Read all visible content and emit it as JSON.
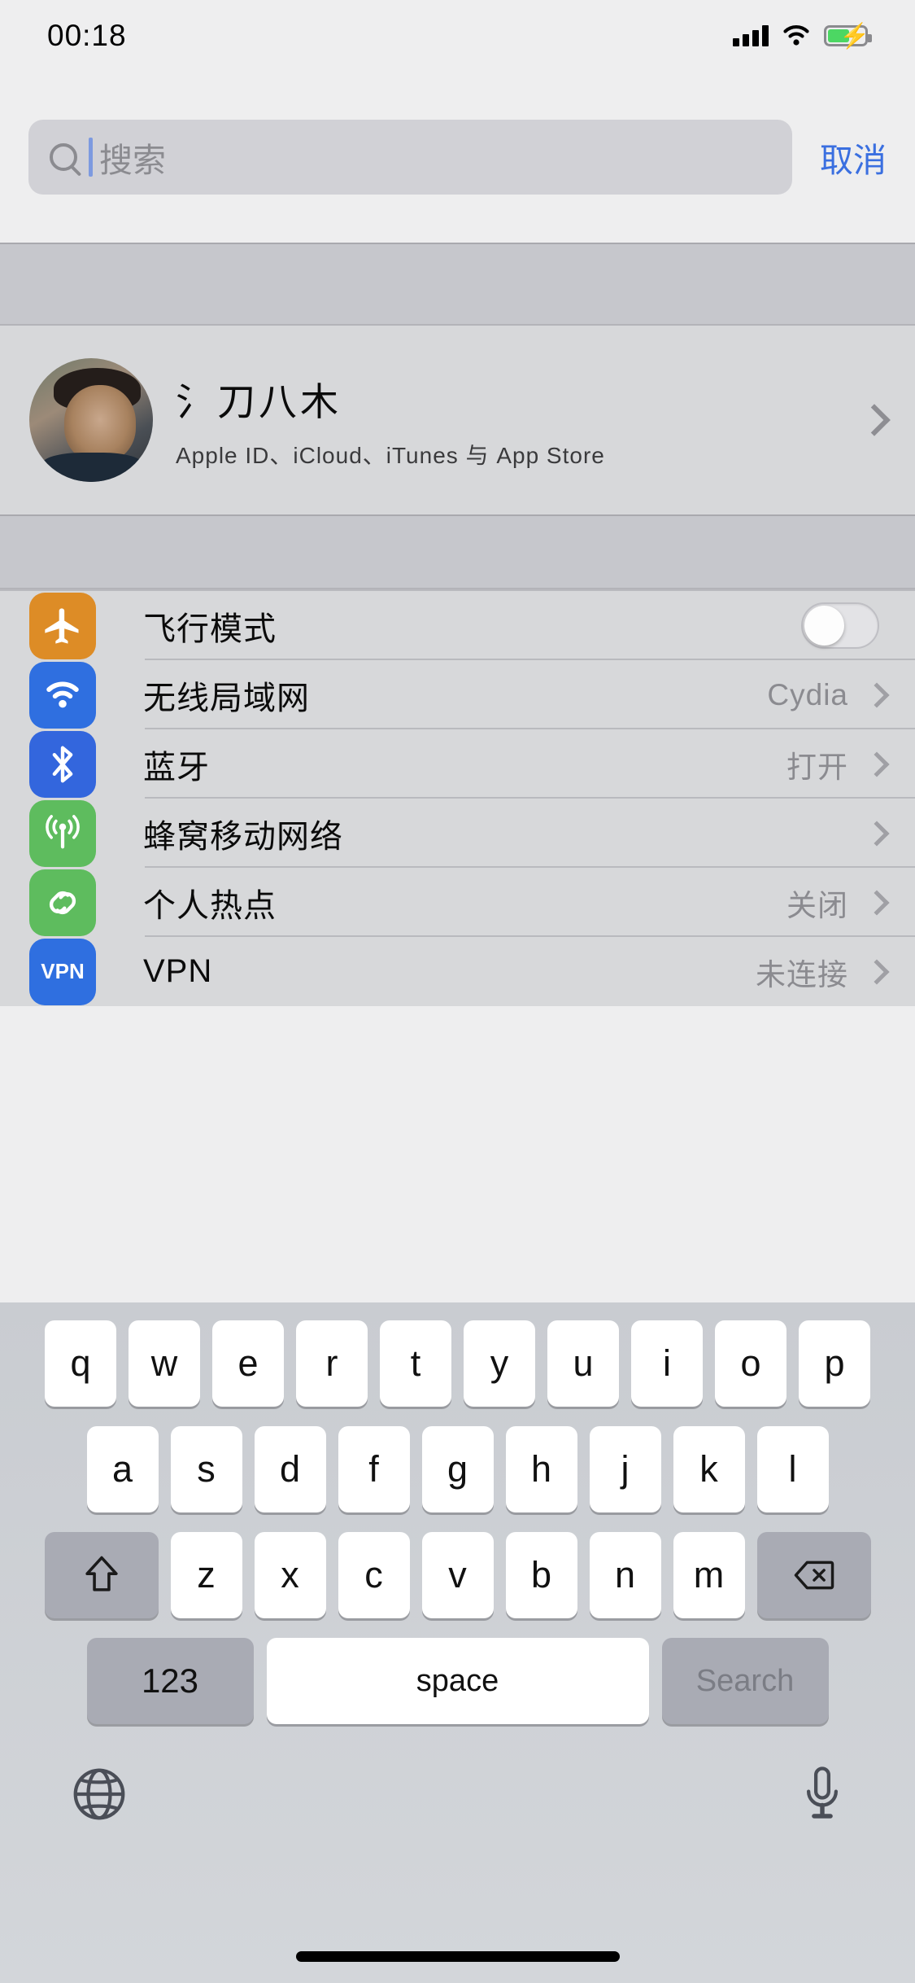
{
  "status_bar": {
    "time": "00:18",
    "signal_icon": "signal-bars-icon",
    "wifi_icon": "wifi-icon",
    "battery_icon": "battery-charging-icon",
    "battery_level_pct": 58
  },
  "search": {
    "placeholder": "搜索",
    "value": "",
    "icon": "search-icon",
    "cancel_label": "取消"
  },
  "profile": {
    "name": "氵刀八木",
    "subtitle": "Apple ID、iCloud、iTunes 与 App Store",
    "avatar_name": "user-avatar"
  },
  "settings_rows": [
    {
      "label": "飞行模式",
      "value": "",
      "icon": "airplane-icon",
      "control": "toggle",
      "toggle_on": false,
      "name": "airplane-mode"
    },
    {
      "label": "无线局域网",
      "value": "Cydia",
      "icon": "wifi-icon",
      "control": "chevron",
      "name": "wifi"
    },
    {
      "label": "蓝牙",
      "value": "打开",
      "icon": "bluetooth-icon",
      "control": "chevron",
      "name": "bluetooth"
    },
    {
      "label": "蜂窝移动网络",
      "value": "",
      "icon": "cellular-icon",
      "control": "chevron",
      "name": "cellular"
    },
    {
      "label": "个人热点",
      "value": "关闭",
      "icon": "hotspot-icon",
      "control": "chevron",
      "name": "personal-hotspot"
    },
    {
      "label": "VPN",
      "value": "未连接",
      "icon": "vpn-icon",
      "icon_text": "VPN",
      "control": "chevron",
      "name": "vpn"
    }
  ],
  "keyboard": {
    "row1": [
      "q",
      "w",
      "e",
      "r",
      "t",
      "y",
      "u",
      "i",
      "o",
      "p"
    ],
    "row2": [
      "a",
      "s",
      "d",
      "f",
      "g",
      "h",
      "j",
      "k",
      "l"
    ],
    "row3": [
      "z",
      "x",
      "c",
      "v",
      "b",
      "n",
      "m"
    ],
    "shift_icon": "shift-icon",
    "delete_icon": "delete-icon",
    "numbers_label": "123",
    "space_label": "space",
    "return_label": "Search",
    "globe_icon": "globe-icon",
    "mic_icon": "microphone-icon"
  },
  "colors": {
    "accent_blue": "#3a6fe0",
    "airplane_orange": "#dd8c26",
    "wifi_blue": "#2f6fe0",
    "bluetooth_blue": "#3366dd",
    "cellular_green": "#5ebc5e",
    "hotspot_green": "#5ebc5e",
    "vpn_blue": "#2f6fe0",
    "battery_green": "#4cd763"
  }
}
